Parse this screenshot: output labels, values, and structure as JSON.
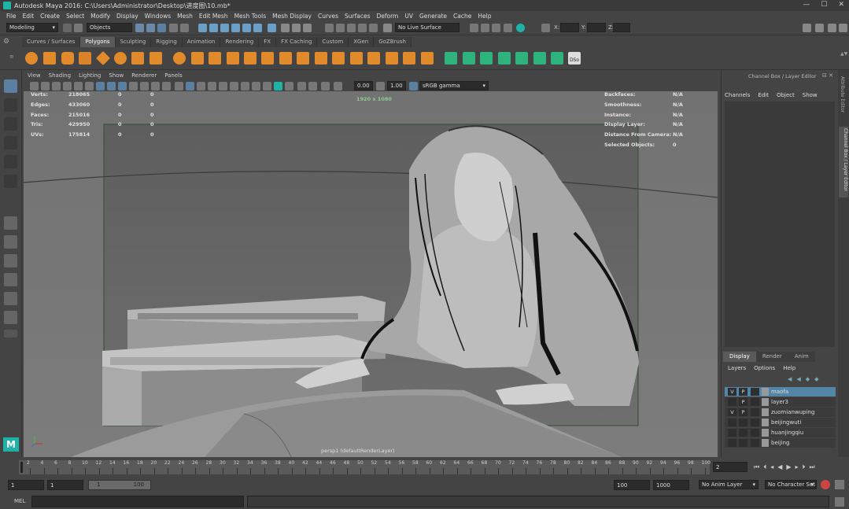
{
  "window": {
    "title": "Autodesk Maya 2016: C:\\Users\\Administrator\\Desktop\\进度图\\10.mb*",
    "controls": [
      "—",
      "☐",
      "✕"
    ]
  },
  "menubar": [
    "File",
    "Edit",
    "Create",
    "Select",
    "Modify",
    "Display",
    "Windows",
    "Mesh",
    "Edit Mesh",
    "Mesh Tools",
    "Mesh Display",
    "Curves",
    "Surfaces",
    "Deform",
    "UV",
    "Generate",
    "Cache",
    "Help"
  ],
  "statusline": {
    "menuset": "Modeling",
    "selection_mode": "Objects",
    "live_surface": "No Live Surface",
    "coord_labels": [
      "X:",
      "Y:",
      "Z:"
    ]
  },
  "shelf_tabs": [
    "Curves / Surfaces",
    "Polygons",
    "Sculpting",
    "Rigging",
    "Animation",
    "Rendering",
    "FX",
    "FX Caching",
    "Custom",
    "XGen",
    "GoZBrush"
  ],
  "shelf_active_tab": "Polygons",
  "shelf_last_label": "DSo",
  "viewport": {
    "menu": [
      "View",
      "Shading",
      "Lighting",
      "Show",
      "Renderer",
      "Panels"
    ],
    "exposure": "0.00",
    "gamma": "1.00",
    "color_space": "sRGB gamma",
    "resolution": "1920 x 1080",
    "camera_label": "persp1 (defaultRenderLayer)",
    "hud_left": [
      {
        "label": "Verts:",
        "v1": "218065",
        "v2": "0",
        "v3": "0"
      },
      {
        "label": "Edges:",
        "v1": "433060",
        "v2": "0",
        "v3": "0"
      },
      {
        "label": "Faces:",
        "v1": "215016",
        "v2": "0",
        "v3": "0"
      },
      {
        "label": "Tris:",
        "v1": "429950",
        "v2": "0",
        "v3": "0"
      },
      {
        "label": "UVs:",
        "v1": "175814",
        "v2": "0",
        "v3": "0"
      }
    ],
    "hud_right": [
      {
        "label": "Backfaces:",
        "value": "N/A"
      },
      {
        "label": "Smoothness:",
        "value": "N/A"
      },
      {
        "label": "Instance:",
        "value": "N/A"
      },
      {
        "label": "Display Layer:",
        "value": "N/A"
      },
      {
        "label": "Distance From Camera:",
        "value": "N/A"
      },
      {
        "label": "Selected Objects:",
        "value": "0"
      }
    ]
  },
  "channel_box": {
    "title": "Channel Box / Layer Editor",
    "menu": [
      "Channels",
      "Edit",
      "Object",
      "Show"
    ]
  },
  "layer_editor": {
    "tabs": [
      "Display",
      "Render",
      "Anim"
    ],
    "menu": [
      "Layers",
      "Options",
      "Help"
    ],
    "layers": [
      {
        "v": "V",
        "p": "P",
        "name": "maofa",
        "selected": true
      },
      {
        "v": "",
        "p": "P",
        "name": "layer3",
        "selected": false
      },
      {
        "v": "V",
        "p": "P",
        "name": "zuomianwuping",
        "selected": false
      },
      {
        "v": "",
        "p": "",
        "name": "beijingwuti",
        "selected": false
      },
      {
        "v": "",
        "p": "",
        "name": "huanjingqiu",
        "selected": false
      },
      {
        "v": "",
        "p": "",
        "name": "beijing",
        "selected": false
      }
    ]
  },
  "side_tabs": [
    "Attribute Editor",
    "Channel Box / Layer Editor"
  ],
  "time_slider": {
    "ticks": [
      "2",
      "4",
      "6",
      "8",
      "10",
      "12",
      "14",
      "16",
      "18",
      "20",
      "22",
      "24",
      "26",
      "28",
      "30",
      "32",
      "34",
      "36",
      "38",
      "40",
      "42",
      "44",
      "46",
      "48",
      "50",
      "52",
      "54",
      "56",
      "58",
      "60",
      "62",
      "64",
      "66",
      "68",
      "70",
      "72",
      "74",
      "76",
      "78",
      "80",
      "82",
      "84",
      "86",
      "88",
      "90",
      "92",
      "94",
      "96",
      "98",
      "100"
    ],
    "current_frame": "2"
  },
  "range_slider": {
    "start": "1",
    "start_inner": "1",
    "range_start": "1",
    "range_end": "100",
    "end_inner": "100",
    "end": "1000",
    "anim_layer": "No Anim Layer",
    "character_set": "No Character Set"
  },
  "command_line": {
    "label": "MEL"
  },
  "colors": {
    "selected_layer": "#5285a6",
    "accent": "#1fb3a8",
    "shelf_icon": "#e08a2c"
  }
}
